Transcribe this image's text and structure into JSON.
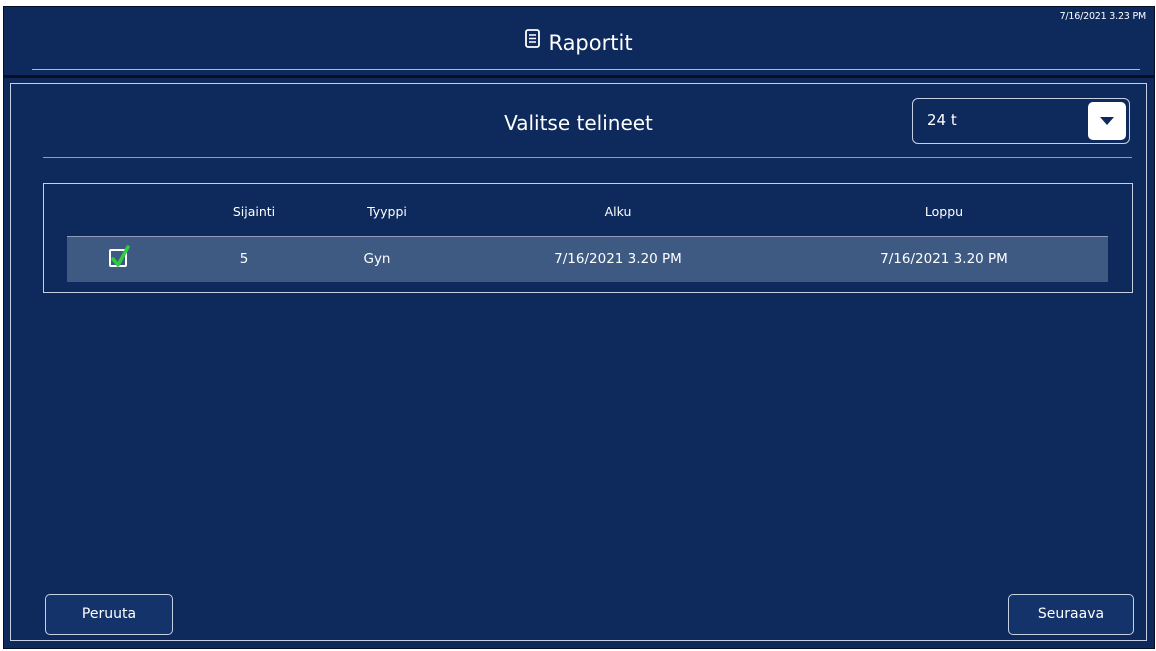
{
  "header": {
    "title": "Raportit",
    "datetime": "7/16/2021 3.23 PM",
    "title_icon": "report-document-icon"
  },
  "page": {
    "heading": "Valitse telineet",
    "range_select": {
      "selected": "24 t",
      "dropdown_icon": "caret-down-icon"
    }
  },
  "table": {
    "columns": [
      "",
      "Sijainti",
      "Tyyppi",
      "Alku",
      "Loppu"
    ],
    "rows": [
      {
        "checked": true,
        "location": "5",
        "type": "Gyn",
        "start": "7/16/2021 3.20 PM",
        "end": "7/16/2021 3.20 PM"
      }
    ]
  },
  "footer": {
    "cancel_label": "Peruuta",
    "next_label": "Seuraava"
  },
  "colors": {
    "background": "#0e2a5d",
    "row_selected": "#3e5a83",
    "check": "#2ecc40"
  }
}
